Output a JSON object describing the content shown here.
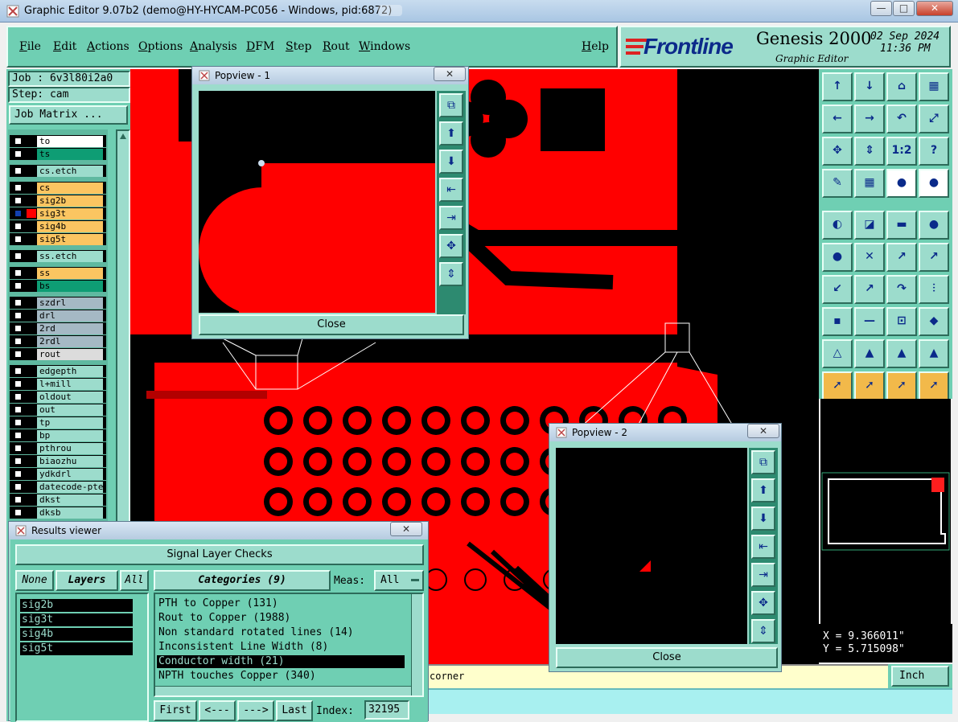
{
  "window": {
    "title": "Graphic Editor 9.07b2 (demo@HY-HYCAM-PC056 - Windows, pid:6872)",
    "minimize": "—",
    "maximize": "□",
    "close": "✕"
  },
  "menu": {
    "items": [
      "File",
      "Edit",
      "Actions",
      "Options",
      "Analysis",
      "DFM",
      "Step",
      "Rout",
      "Windows"
    ],
    "help": "Help"
  },
  "brand": {
    "logo": "Frontline",
    "product": "Genesis 2000",
    "subtitle": "Graphic Editor",
    "date": "02 Sep 2024",
    "time": "11:36 PM"
  },
  "job": {
    "job_label": "Job : 6v3l80i2a0",
    "step_label": "Step: cam",
    "matrix_button": "Job Matrix ..."
  },
  "layers": [
    {
      "name": "to",
      "color": "#ffffff"
    },
    {
      "name": "ts",
      "color": "#0e9d74"
    },
    {
      "name": "cs.etch",
      "color": "#9cdccc"
    },
    {
      "name": "cs",
      "color": "#fbc561"
    },
    {
      "name": "sig2b",
      "color": "#fbc561"
    },
    {
      "name": "sig3t",
      "color": "#fbc561"
    },
    {
      "name": "sig4b",
      "color": "#fbc561"
    },
    {
      "name": "sig5t",
      "color": "#fbc561"
    },
    {
      "name": "ss.etch",
      "color": "#9cdccc"
    },
    {
      "name": "ss",
      "color": "#fbc561"
    },
    {
      "name": "bs",
      "color": "#0e9d74"
    },
    {
      "name": "szdrl",
      "color": "#a5b9c4"
    },
    {
      "name": "drl",
      "color": "#a5b9c4"
    },
    {
      "name": "2rd",
      "color": "#a5b9c4"
    },
    {
      "name": "2rdl",
      "color": "#a5b9c4"
    },
    {
      "name": "rout",
      "color": "#dcdcdc"
    },
    {
      "name": "edgepth",
      "color": "#9cdccc"
    },
    {
      "name": "l+mill",
      "color": "#9cdccc"
    },
    {
      "name": "oldout",
      "color": "#9cdccc"
    },
    {
      "name": "out",
      "color": "#9cdccc"
    },
    {
      "name": "tp",
      "color": "#9cdccc"
    },
    {
      "name": "bp",
      "color": "#9cdccc"
    },
    {
      "name": "pthrou",
      "color": "#9cdccc"
    },
    {
      "name": "biaozhu",
      "color": "#9cdccc"
    },
    {
      "name": "ydkdrl",
      "color": "#9cdccc"
    },
    {
      "name": "datecode-pte",
      "color": "#9cdccc"
    },
    {
      "name": "dkst",
      "color": "#9cdccc"
    },
    {
      "name": "dksb",
      "color": "#9cdccc"
    }
  ],
  "popview1": {
    "title": "Popview - 1",
    "close": "Close"
  },
  "popview2": {
    "title": "Popview - 2",
    "close": "Close"
  },
  "results": {
    "title": "Results viewer",
    "header": "Signal Layer Checks",
    "none": "None",
    "layers_label": "Layers",
    "all": "All",
    "categories_label": "Categories (9)",
    "meas_label": "Meas:",
    "meas_value": "All",
    "layer_list": [
      "sig2b",
      "sig3t",
      "sig4b",
      "sig5t"
    ],
    "categories": [
      "PTH to Copper (131)",
      "Rout to Copper (1988)",
      "Non standard rotated lines (14)",
      "Inconsistent Line Width (8)",
      "Conductor width (21)",
      "NPTH touches Copper (340)"
    ],
    "selected_index": 4,
    "first": "First",
    "prev": "<---",
    "next": "--->",
    "last": "Last",
    "index_label": "Index:",
    "index_value": "32195"
  },
  "status": {
    "message": "corner",
    "x": "X = 9.366011\"",
    "y": "Y = 5.715098\"",
    "units": "Inch"
  },
  "colors": {
    "copper": "#ff0000",
    "background": "#000000",
    "panel": "#9cdccc",
    "highlight_tool": "#f2b94a"
  }
}
